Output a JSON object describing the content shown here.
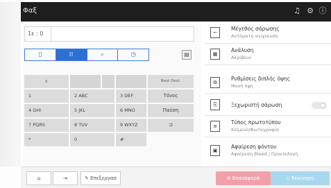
{
  "top_bar": {
    "title": "Φαξ",
    "icons": [
      "bell-icon",
      "settings-icon",
      "info-icon"
    ]
  },
  "address": {
    "value": "1ε : 0"
  },
  "tabs": [
    {
      "icon": "address-book-icon",
      "glyph": "▯"
    },
    {
      "icon": "keypad-icon",
      "glyph": "⁞⁞"
    },
    {
      "icon": "search-icon",
      "glyph": "⌕"
    },
    {
      "icon": "history-icon",
      "glyph": "◷"
    }
  ],
  "side_button": {
    "icon": "list-icon",
    "glyph": "▤"
  },
  "keypad": {
    "row1": {
      "c": "c",
      "next": "Next Dest."
    },
    "row2": {
      "k1": "1",
      "k2": "2 ABC",
      "k3": "3 DEF",
      "right": "Τόνος"
    },
    "row3": {
      "k1": "4 GHI",
      "k2": "5 JKL",
      "k3": "6 MNO",
      "right": "Παύση"
    },
    "row4": {
      "k1": "7 PQRS",
      "k2": "8 TUV",
      "k3": "9 WXYZ",
      "right": "⊐"
    },
    "row5": {
      "k1": "*",
      "k2": "0",
      "k3": "#"
    }
  },
  "options": [
    {
      "title": "Μέγεθος σάρωσης",
      "sub": "Αυτόματη ανίχνευση",
      "glyph": "⌐"
    },
    {
      "title": "Ανάλυση",
      "sub": "Ακρίβεια",
      "glyph": "▦"
    },
    {
      "title": "Ρυθμίσεις διπλής όψης",
      "sub": "Μονή όψη",
      "glyph": "⧉"
    },
    {
      "title": "Ξεχωριστή σάρωση",
      "sub": "",
      "glyph": "⎘"
    },
    {
      "title": "Τύπος πρωτοτύπου",
      "sub": "Κείμενο/Φωτογραφία",
      "glyph": "≡"
    },
    {
      "title": "Αφαίρεση φόντου",
      "sub": "Αφαίρεση Bleed / Προεπιλογή",
      "glyph": "▣"
    }
  ],
  "bottom": {
    "home_glyph": "⌂",
    "job_glyph": "⇥",
    "edit_label": "Επεξεργασ",
    "edit_glyph": "✎",
    "reset_label": "Επαναφορά",
    "reset_glyph": "⊘",
    "start_label": "Εκκίνηση",
    "start_glyph": "◇"
  },
  "colors": {
    "accent": "#2e6fd2",
    "reset": "#f2a0a8",
    "start": "#a8d8ee",
    "topbar": "#1e1e1e"
  }
}
